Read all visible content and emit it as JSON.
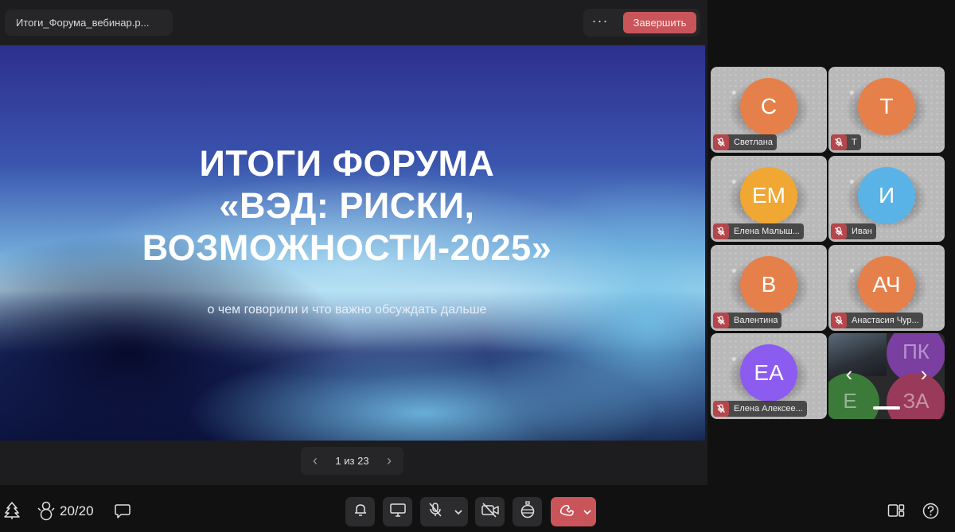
{
  "header": {
    "file_name": "Итоги_Форума_вебинар.p...",
    "more_label": "···",
    "end_button": "Завершить"
  },
  "slide": {
    "title_line1": "ИТОГИ ФОРУМА",
    "title_line2": "«ВЭД: РИСКИ,",
    "title_line3": "ВОЗМОЖНОСТИ-2025»",
    "subtitle": "о чем говорили и что важно обсуждать дальше"
  },
  "pager": {
    "prev": "‹",
    "text": "1 из 23",
    "next": "›"
  },
  "participants": [
    {
      "initials": "С",
      "name": "Светлана",
      "color": "#e5804a"
    },
    {
      "initials": "Т",
      "name": "Т",
      "color": "#e5804a"
    },
    {
      "initials": "ЕМ",
      "name": "Елена Малыш...",
      "color": "#f0a733"
    },
    {
      "initials": "И",
      "name": "Иван",
      "color": "#5ab3e6"
    },
    {
      "initials": "В",
      "name": "Валентина",
      "color": "#e5804a"
    },
    {
      "initials": "АЧ",
      "name": "Анастасия Чур...",
      "color": "#e5804a"
    },
    {
      "initials": "ЕА",
      "name": "Елена Алексее...",
      "color": "#8c5bf0"
    }
  ],
  "overflow_tile": {
    "initials": [
      "ПК",
      "Е",
      "ЗА"
    ],
    "colors": [
      "#7a3fa0",
      "#3c7a3a",
      "#9a3a5a"
    ],
    "prev_arrow": "‹",
    "next_arrow": "›"
  },
  "bottom_bar": {
    "participant_count": "20/20",
    "icons": [
      "tree-icon",
      "snowman-icon",
      "chat-icon",
      "bell-icon",
      "screen-share-icon",
      "mic-muted-icon",
      "chevron-down-icon",
      "camera-off-icon",
      "ornament-icon",
      "hangup-icon",
      "chevron-down-icon",
      "layout-icon",
      "help-icon"
    ],
    "hangup_color": "#c9555a"
  }
}
